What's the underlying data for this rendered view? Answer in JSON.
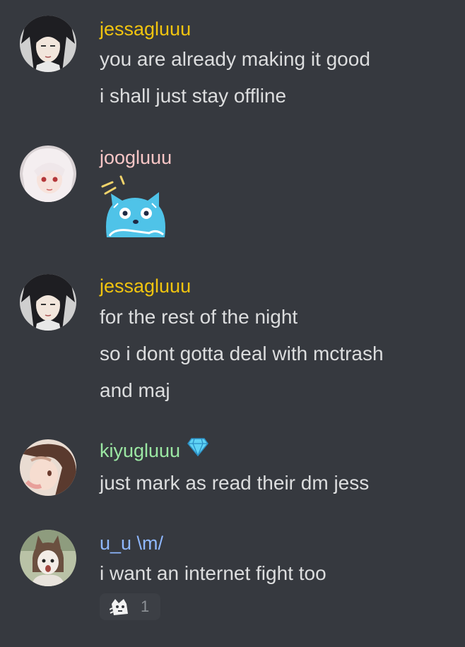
{
  "colors": {
    "background": "#36393f",
    "message_text": "#dcddde",
    "jessa_name": "#f1c40f",
    "joo_name": "#f8c6c6",
    "kiyu_name": "#9be7a3",
    "uu_name": "#8fb8ff"
  },
  "messages": [
    {
      "author": "jessagluuu",
      "avatar_icon": "dark-haired-anime-avatar",
      "lines": [
        "you are already making it good",
        "i shall just stay offline"
      ]
    },
    {
      "author": "joogluuu",
      "avatar_icon": "white-haired-anime-avatar",
      "sticker": "blue-cat-sticker"
    },
    {
      "author": "jessagluuu",
      "avatar_icon": "dark-haired-anime-avatar",
      "lines": [
        "for the rest of the night",
        "so i dont gotta deal with mctrash",
        "and maj"
      ]
    },
    {
      "author": "kiyugluuu",
      "avatar_icon": "long-haired-anime-avatar",
      "badge_icon": "diamond-icon",
      "lines": [
        "just mark as read their dm jess"
      ]
    },
    {
      "author": "u_u \\m/",
      "avatar_icon": "cat-eared-avatar",
      "lines": [
        "i want an internet fight too"
      ],
      "reaction": {
        "icon": "emoji-reaction-icon",
        "count": "1"
      }
    }
  ]
}
